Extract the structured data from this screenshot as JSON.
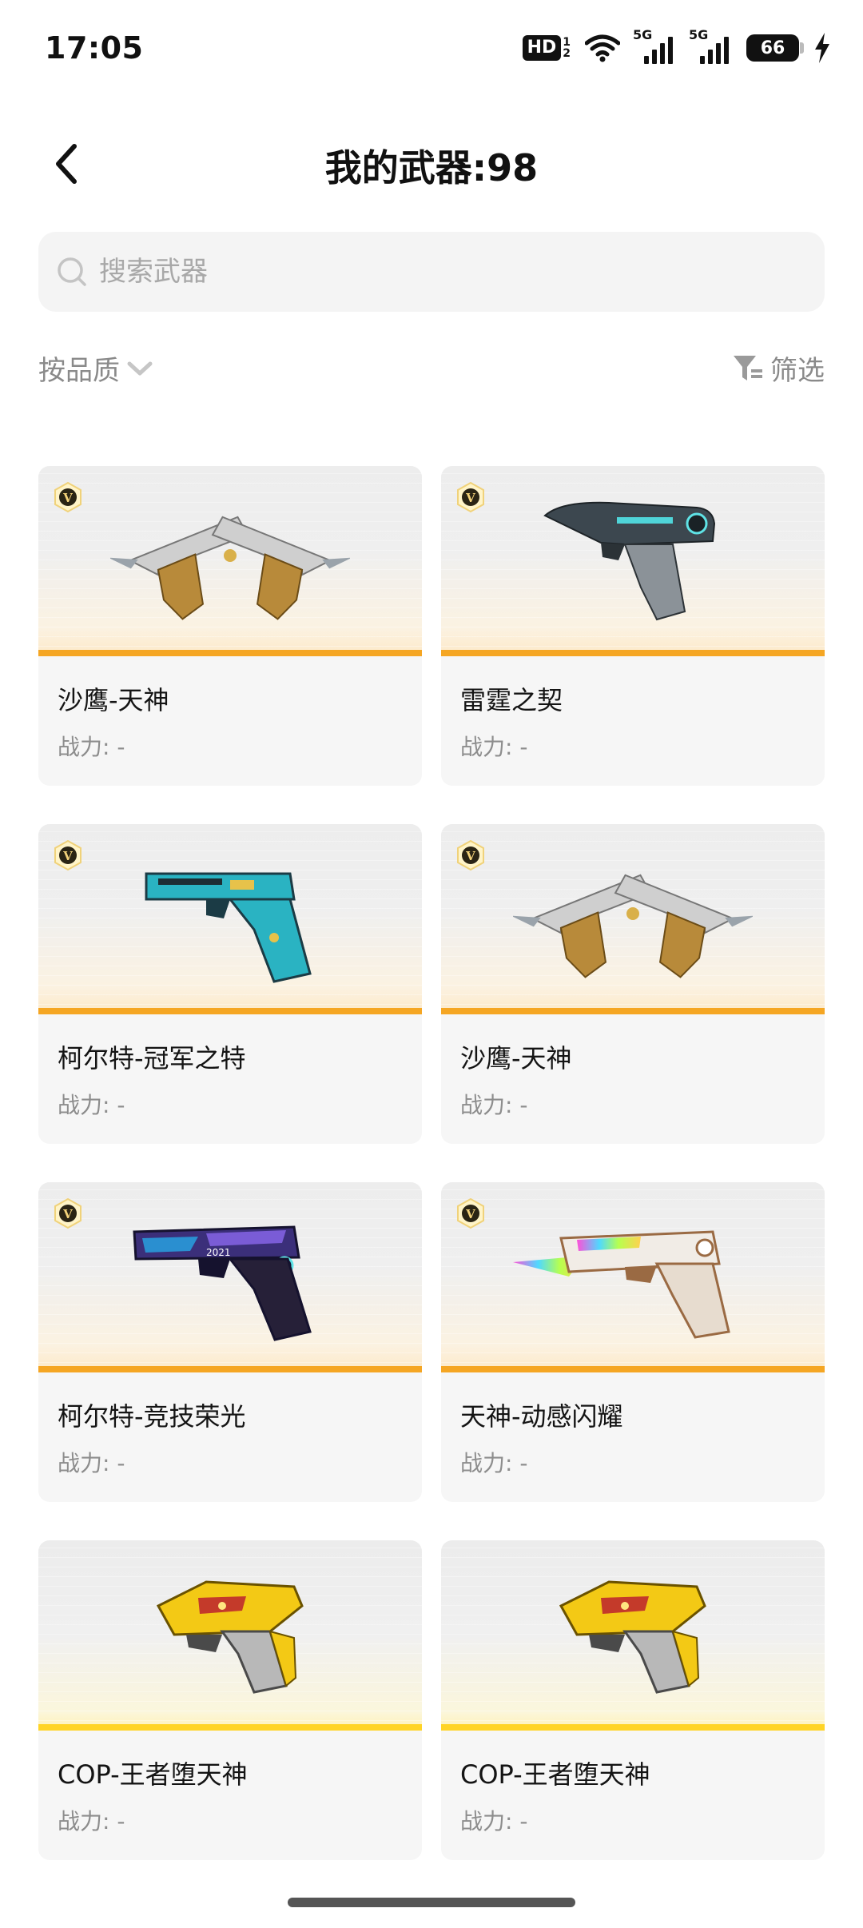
{
  "status_bar": {
    "time": "17:05",
    "hd_label": "HD",
    "hd_sub_top": "1",
    "hd_sub_bottom": "2",
    "signal_1_label": "5G",
    "signal_2_label": "5G",
    "battery_level": "66"
  },
  "header": {
    "title": "我的武器:98"
  },
  "search": {
    "placeholder": "搜索武器"
  },
  "filters": {
    "sort_label": "按品质",
    "filter_label": "筛选"
  },
  "colors": {
    "rarity_orange": "#f5a623",
    "rarity_gold": "#ffd426"
  },
  "weapons": [
    {
      "name": "沙鹰-天神",
      "power": "战力: -",
      "badge": "V",
      "art": "dual-pistol-gold-icon"
    },
    {
      "name": "雷霆之契",
      "power": "战力: -",
      "badge": "V",
      "art": "pistol-dark-icon"
    },
    {
      "name": "柯尔特-冠军之特",
      "power": "战力: -",
      "badge": "V",
      "art": "pistol-teal-icon"
    },
    {
      "name": "沙鹰-天神",
      "power": "战力: -",
      "badge": "V",
      "art": "dual-pistol-gold-icon"
    },
    {
      "name": "柯尔特-竞技荣光",
      "power": "战力: -",
      "badge": "V",
      "art": "pistol-purple-icon",
      "art_text": "2021"
    },
    {
      "name": "天神-动感闪耀",
      "power": "战力: -",
      "badge": "V",
      "art": "pistol-rainbow-icon"
    },
    {
      "name": "COP-王者堕天神",
      "power": "战力: -",
      "art": "pistol-yellow-icon"
    },
    {
      "name": "COP-王者堕天神",
      "power": "战力: -",
      "art": "pistol-yellow-icon"
    }
  ]
}
